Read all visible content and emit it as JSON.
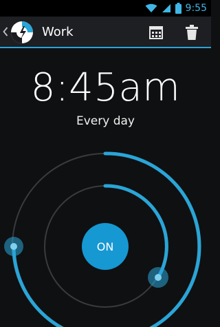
{
  "status_bar": {
    "time": "9:55",
    "icons": [
      "wifi-icon",
      "signal-icon",
      "battery-icon"
    ]
  },
  "action_bar": {
    "title": "Work",
    "actions": [
      "calendar-icon",
      "trash-icon"
    ]
  },
  "alarm": {
    "time": "8:45am",
    "recurrence": "Every day",
    "toggle_label": "ON"
  },
  "colors": {
    "accent": "#2aa5d7",
    "button": "#1698d2",
    "track": "#3a3b3e",
    "background": "#0f1012"
  }
}
